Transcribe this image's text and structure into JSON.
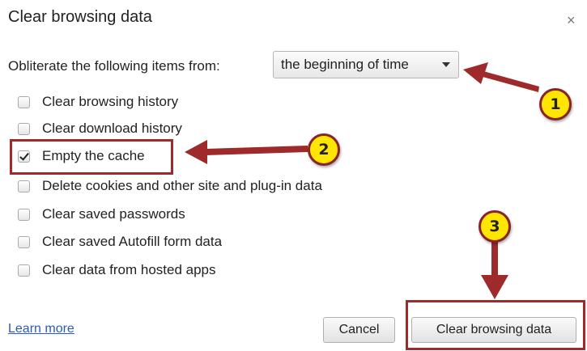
{
  "dialog": {
    "title": "Clear browsing data",
    "close_glyph": "×"
  },
  "time_range": {
    "label": "Obliterate the following items from:",
    "selected": "the beginning of time"
  },
  "options": [
    {
      "label": "Clear browsing history",
      "checked": false
    },
    {
      "label": "Clear download history",
      "checked": false
    },
    {
      "label": "Empty the cache",
      "checked": true
    },
    {
      "label": "Delete cookies and other site and plug-in data",
      "checked": false
    },
    {
      "label": "Clear saved passwords",
      "checked": false
    },
    {
      "label": "Clear saved Autofill form data",
      "checked": false
    },
    {
      "label": "Clear data from hosted apps",
      "checked": false
    }
  ],
  "footer": {
    "learn_more": "Learn more",
    "cancel_label": "Cancel",
    "confirm_label": "Clear browsing data"
  },
  "callouts": {
    "one": "1",
    "two": "2",
    "three": "3"
  },
  "colors": {
    "annotation_red": "#9e2a2b",
    "callout_yellow": "#ffe600",
    "link_blue": "#2a5db0"
  },
  "icons": {
    "close": "close-icon",
    "dropdown": "chevron-down-icon",
    "check": "checkmark-icon"
  }
}
